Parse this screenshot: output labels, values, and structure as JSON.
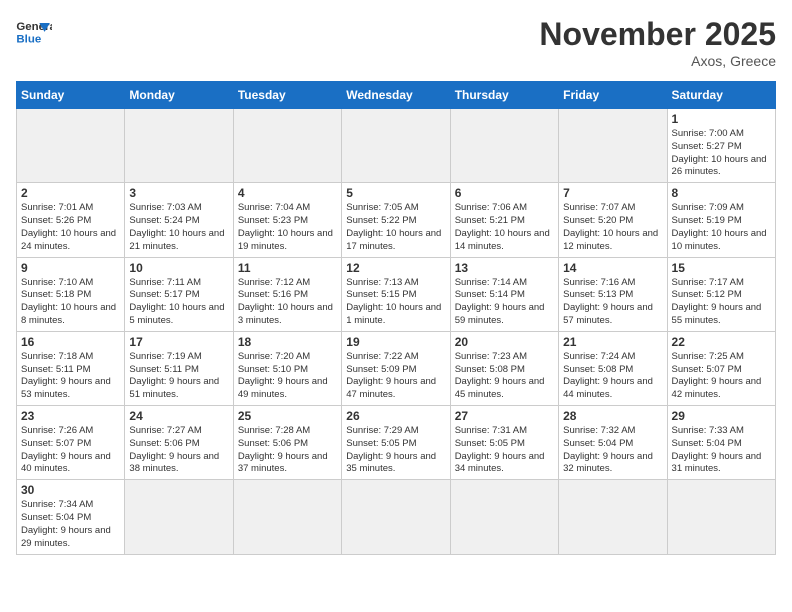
{
  "header": {
    "logo_general": "General",
    "logo_blue": "Blue",
    "month": "November 2025",
    "location": "Axos, Greece"
  },
  "weekdays": [
    "Sunday",
    "Monday",
    "Tuesday",
    "Wednesday",
    "Thursday",
    "Friday",
    "Saturday"
  ],
  "days": {
    "1": {
      "sunrise": "7:00 AM",
      "sunset": "5:27 PM",
      "daylight": "10 hours and 26 minutes."
    },
    "2": {
      "sunrise": "7:01 AM",
      "sunset": "5:26 PM",
      "daylight": "10 hours and 24 minutes."
    },
    "3": {
      "sunrise": "7:03 AM",
      "sunset": "5:24 PM",
      "daylight": "10 hours and 21 minutes."
    },
    "4": {
      "sunrise": "7:04 AM",
      "sunset": "5:23 PM",
      "daylight": "10 hours and 19 minutes."
    },
    "5": {
      "sunrise": "7:05 AM",
      "sunset": "5:22 PM",
      "daylight": "10 hours and 17 minutes."
    },
    "6": {
      "sunrise": "7:06 AM",
      "sunset": "5:21 PM",
      "daylight": "10 hours and 14 minutes."
    },
    "7": {
      "sunrise": "7:07 AM",
      "sunset": "5:20 PM",
      "daylight": "10 hours and 12 minutes."
    },
    "8": {
      "sunrise": "7:09 AM",
      "sunset": "5:19 PM",
      "daylight": "10 hours and 10 minutes."
    },
    "9": {
      "sunrise": "7:10 AM",
      "sunset": "5:18 PM",
      "daylight": "10 hours and 8 minutes."
    },
    "10": {
      "sunrise": "7:11 AM",
      "sunset": "5:17 PM",
      "daylight": "10 hours and 5 minutes."
    },
    "11": {
      "sunrise": "7:12 AM",
      "sunset": "5:16 PM",
      "daylight": "10 hours and 3 minutes."
    },
    "12": {
      "sunrise": "7:13 AM",
      "sunset": "5:15 PM",
      "daylight": "10 hours and 1 minute."
    },
    "13": {
      "sunrise": "7:14 AM",
      "sunset": "5:14 PM",
      "daylight": "9 hours and 59 minutes."
    },
    "14": {
      "sunrise": "7:16 AM",
      "sunset": "5:13 PM",
      "daylight": "9 hours and 57 minutes."
    },
    "15": {
      "sunrise": "7:17 AM",
      "sunset": "5:12 PM",
      "daylight": "9 hours and 55 minutes."
    },
    "16": {
      "sunrise": "7:18 AM",
      "sunset": "5:11 PM",
      "daylight": "9 hours and 53 minutes."
    },
    "17": {
      "sunrise": "7:19 AM",
      "sunset": "5:11 PM",
      "daylight": "9 hours and 51 minutes."
    },
    "18": {
      "sunrise": "7:20 AM",
      "sunset": "5:10 PM",
      "daylight": "9 hours and 49 minutes."
    },
    "19": {
      "sunrise": "7:22 AM",
      "sunset": "5:09 PM",
      "daylight": "9 hours and 47 minutes."
    },
    "20": {
      "sunrise": "7:23 AM",
      "sunset": "5:08 PM",
      "daylight": "9 hours and 45 minutes."
    },
    "21": {
      "sunrise": "7:24 AM",
      "sunset": "5:08 PM",
      "daylight": "9 hours and 44 minutes."
    },
    "22": {
      "sunrise": "7:25 AM",
      "sunset": "5:07 PM",
      "daylight": "9 hours and 42 minutes."
    },
    "23": {
      "sunrise": "7:26 AM",
      "sunset": "5:07 PM",
      "daylight": "9 hours and 40 minutes."
    },
    "24": {
      "sunrise": "7:27 AM",
      "sunset": "5:06 PM",
      "daylight": "9 hours and 38 minutes."
    },
    "25": {
      "sunrise": "7:28 AM",
      "sunset": "5:06 PM",
      "daylight": "9 hours and 37 minutes."
    },
    "26": {
      "sunrise": "7:29 AM",
      "sunset": "5:05 PM",
      "daylight": "9 hours and 35 minutes."
    },
    "27": {
      "sunrise": "7:31 AM",
      "sunset": "5:05 PM",
      "daylight": "9 hours and 34 minutes."
    },
    "28": {
      "sunrise": "7:32 AM",
      "sunset": "5:04 PM",
      "daylight": "9 hours and 32 minutes."
    },
    "29": {
      "sunrise": "7:33 AM",
      "sunset": "5:04 PM",
      "daylight": "9 hours and 31 minutes."
    },
    "30": {
      "sunrise": "7:34 AM",
      "sunset": "5:04 PM",
      "daylight": "9 hours and 29 minutes."
    }
  },
  "labels": {
    "sunrise": "Sunrise:",
    "sunset": "Sunset:",
    "daylight": "Daylight:"
  }
}
